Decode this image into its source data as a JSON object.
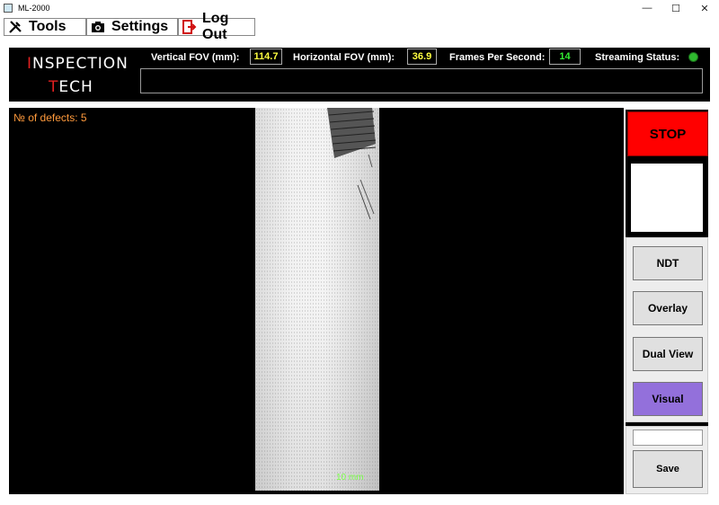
{
  "window": {
    "title": "ML-2000",
    "controls": [
      "—",
      "☐",
      "✕"
    ]
  },
  "menu": {
    "tools": "Tools",
    "settings": "Settings",
    "logout": "Log Out"
  },
  "logo": {
    "line1_first": "I",
    "line1_rest": "NSPECTION",
    "line2_first": "T",
    "line2_rest": "ECH"
  },
  "stats": {
    "vertical_fov_label": "Vertical FOV (mm):",
    "vertical_fov_value": "114.7",
    "horizontal_fov_label": "Horizontal FOV (mm):",
    "horizontal_fov_value": "36.9",
    "fps_label": "Frames Per Second:",
    "fps_value": "14",
    "streaming_label": "Streaming Status:",
    "streaming_color": "#2fb82f"
  },
  "main": {
    "defects": "№ of defects: 5",
    "scan_label": "10 mm"
  },
  "controls": {
    "stop": "STOP",
    "ndt": "NDT",
    "overlay": "Overlay",
    "dual_view": "Dual View",
    "visual": "Visual",
    "save": "Save",
    "active_color": "#9370db",
    "stop_color": "#ff0000"
  }
}
